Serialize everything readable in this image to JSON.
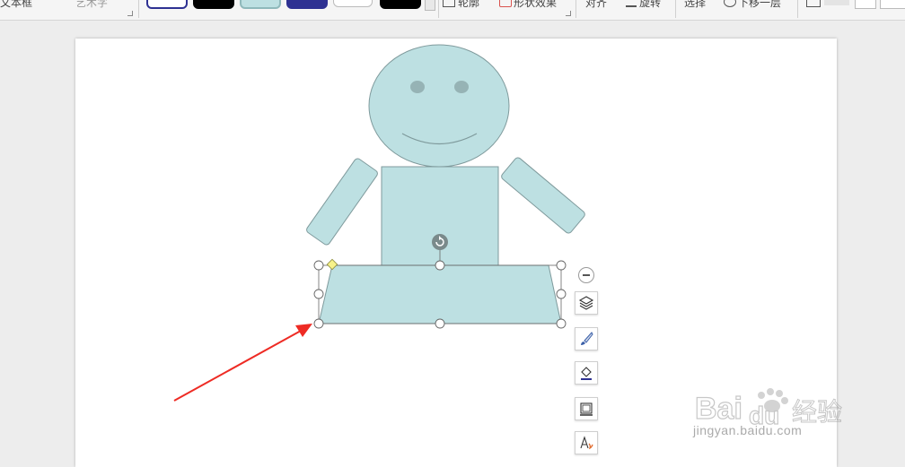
{
  "ribbon": {
    "text_box_label": "文本框",
    "wordart_label": "艺术字",
    "outline_label": "轮廓",
    "shape_effect_label": "形状效果",
    "align_label": "对齐",
    "rotate_label": "旋转",
    "select_label": "选择",
    "move_down_label": "下移一层",
    "swatches": [
      {
        "name": "style-1",
        "fill": "#ffffff",
        "border": "#2e3192"
      },
      {
        "name": "style-2",
        "fill": "#000000",
        "border": "#000000"
      },
      {
        "name": "style-3",
        "fill": "#bde0e2",
        "border": "#8fb9bb"
      },
      {
        "name": "style-4",
        "fill": "#2e3192",
        "border": "#2e3192"
      },
      {
        "name": "style-5",
        "fill": "#ffffff",
        "border": "#bbbbbb"
      },
      {
        "name": "style-6",
        "fill": "#000000",
        "border": "#000000"
      }
    ]
  },
  "shape": {
    "fill": "#bde0e2",
    "stroke": "#7f9a9c",
    "eye_color": "#96b3b5",
    "handle_adjust_color": "#f7f28a"
  },
  "floating_toolbar": {
    "tools": [
      "layers-icon",
      "brush-icon",
      "fill-bucket-icon",
      "shape-outline-icon",
      "text-style-icon"
    ]
  },
  "annotation": {
    "arrow_color": "#ee2b24"
  },
  "watermark": {
    "brand": "Bai du 经验",
    "url": "jingyan.baidu.com"
  }
}
